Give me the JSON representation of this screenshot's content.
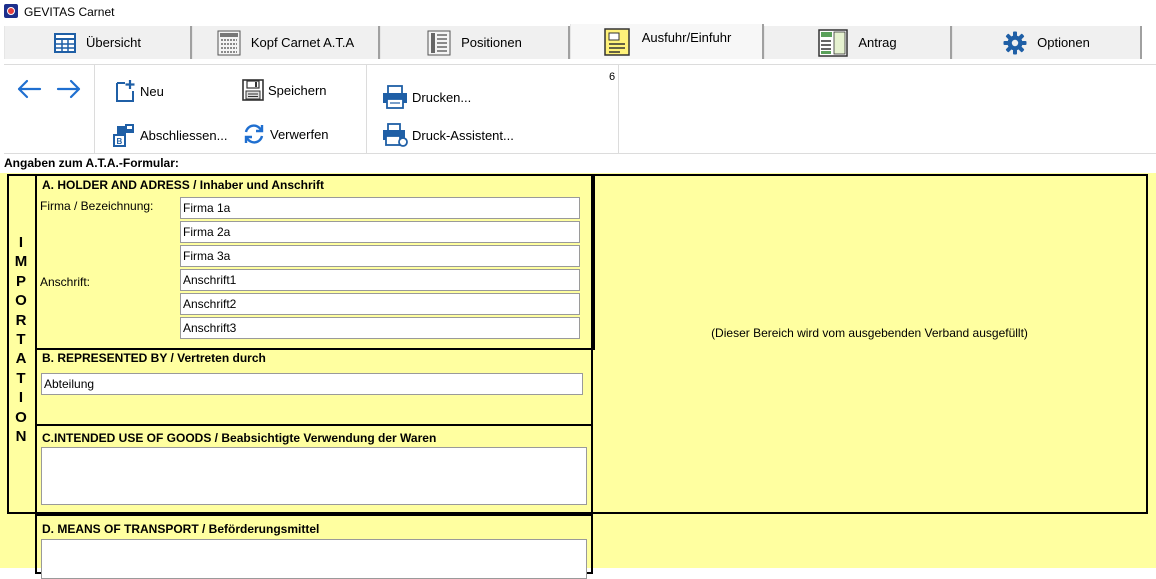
{
  "window": {
    "title": "GEVITAS Carnet"
  },
  "tabs": [
    {
      "label": "Übersicht",
      "icon": "table-icon",
      "active": false
    },
    {
      "label": "Kopf Carnet A.T.A",
      "icon": "document-header-icon",
      "active": false
    },
    {
      "label": "Positionen",
      "icon": "list-document-icon",
      "active": false
    },
    {
      "label": "Ausfuhr/Einfuhr",
      "icon": "notepad-icon",
      "active": true
    },
    {
      "label": "Antrag",
      "icon": "form-icon",
      "active": false
    },
    {
      "label": "Optionen",
      "icon": "gear-icon",
      "active": false
    }
  ],
  "toolbar": {
    "back_icon": "arrow-left-icon",
    "forward_icon": "arrow-right-icon",
    "new_label": "Neu",
    "save_label": "Speichern",
    "finish_label": "Abschliessen...",
    "discard_label": "Verwerfen",
    "print_label": "Drucken...",
    "print_wizard_label": "Druck-Assistent...",
    "page_number": "6"
  },
  "form": {
    "heading": "Angaben zum A.T.A.-Formular:",
    "side_label_letters": [
      "I",
      "M",
      "P",
      "O",
      "R",
      "T",
      "A",
      "T",
      "I",
      "O",
      "N"
    ],
    "holder": {
      "title": "A. HOLDER AND ADRESS / Inhaber und Anschrift",
      "company_label": "Firma / Bezeichnung:",
      "company_lines": [
        "Firma 1a",
        "Firma 2a",
        "Firma 3a"
      ],
      "address_label": "Anschrift:",
      "address_lines": [
        "Anschrift1",
        "Anschrift2",
        "Anschrift3"
      ]
    },
    "represented": {
      "title": "B. REPRESENTED BY / Vertreten durch",
      "value": "Abteilung"
    },
    "intended_use": {
      "title": "C.INTENDED USE OF GOODS / Beabsichtigte Verwendung der Waren",
      "value": ""
    },
    "transport": {
      "title": "D. MEANS OF TRANSPORT / Beförderungsmittel",
      "value": ""
    },
    "issuer_note": "(Dieser Bereich wird vom ausgebenden Verband ausgefüllt)"
  },
  "colors": {
    "form_background": "#ffffa0",
    "icon_blue": "#1f5fa6",
    "arrow_blue": "#1f6fd0"
  }
}
